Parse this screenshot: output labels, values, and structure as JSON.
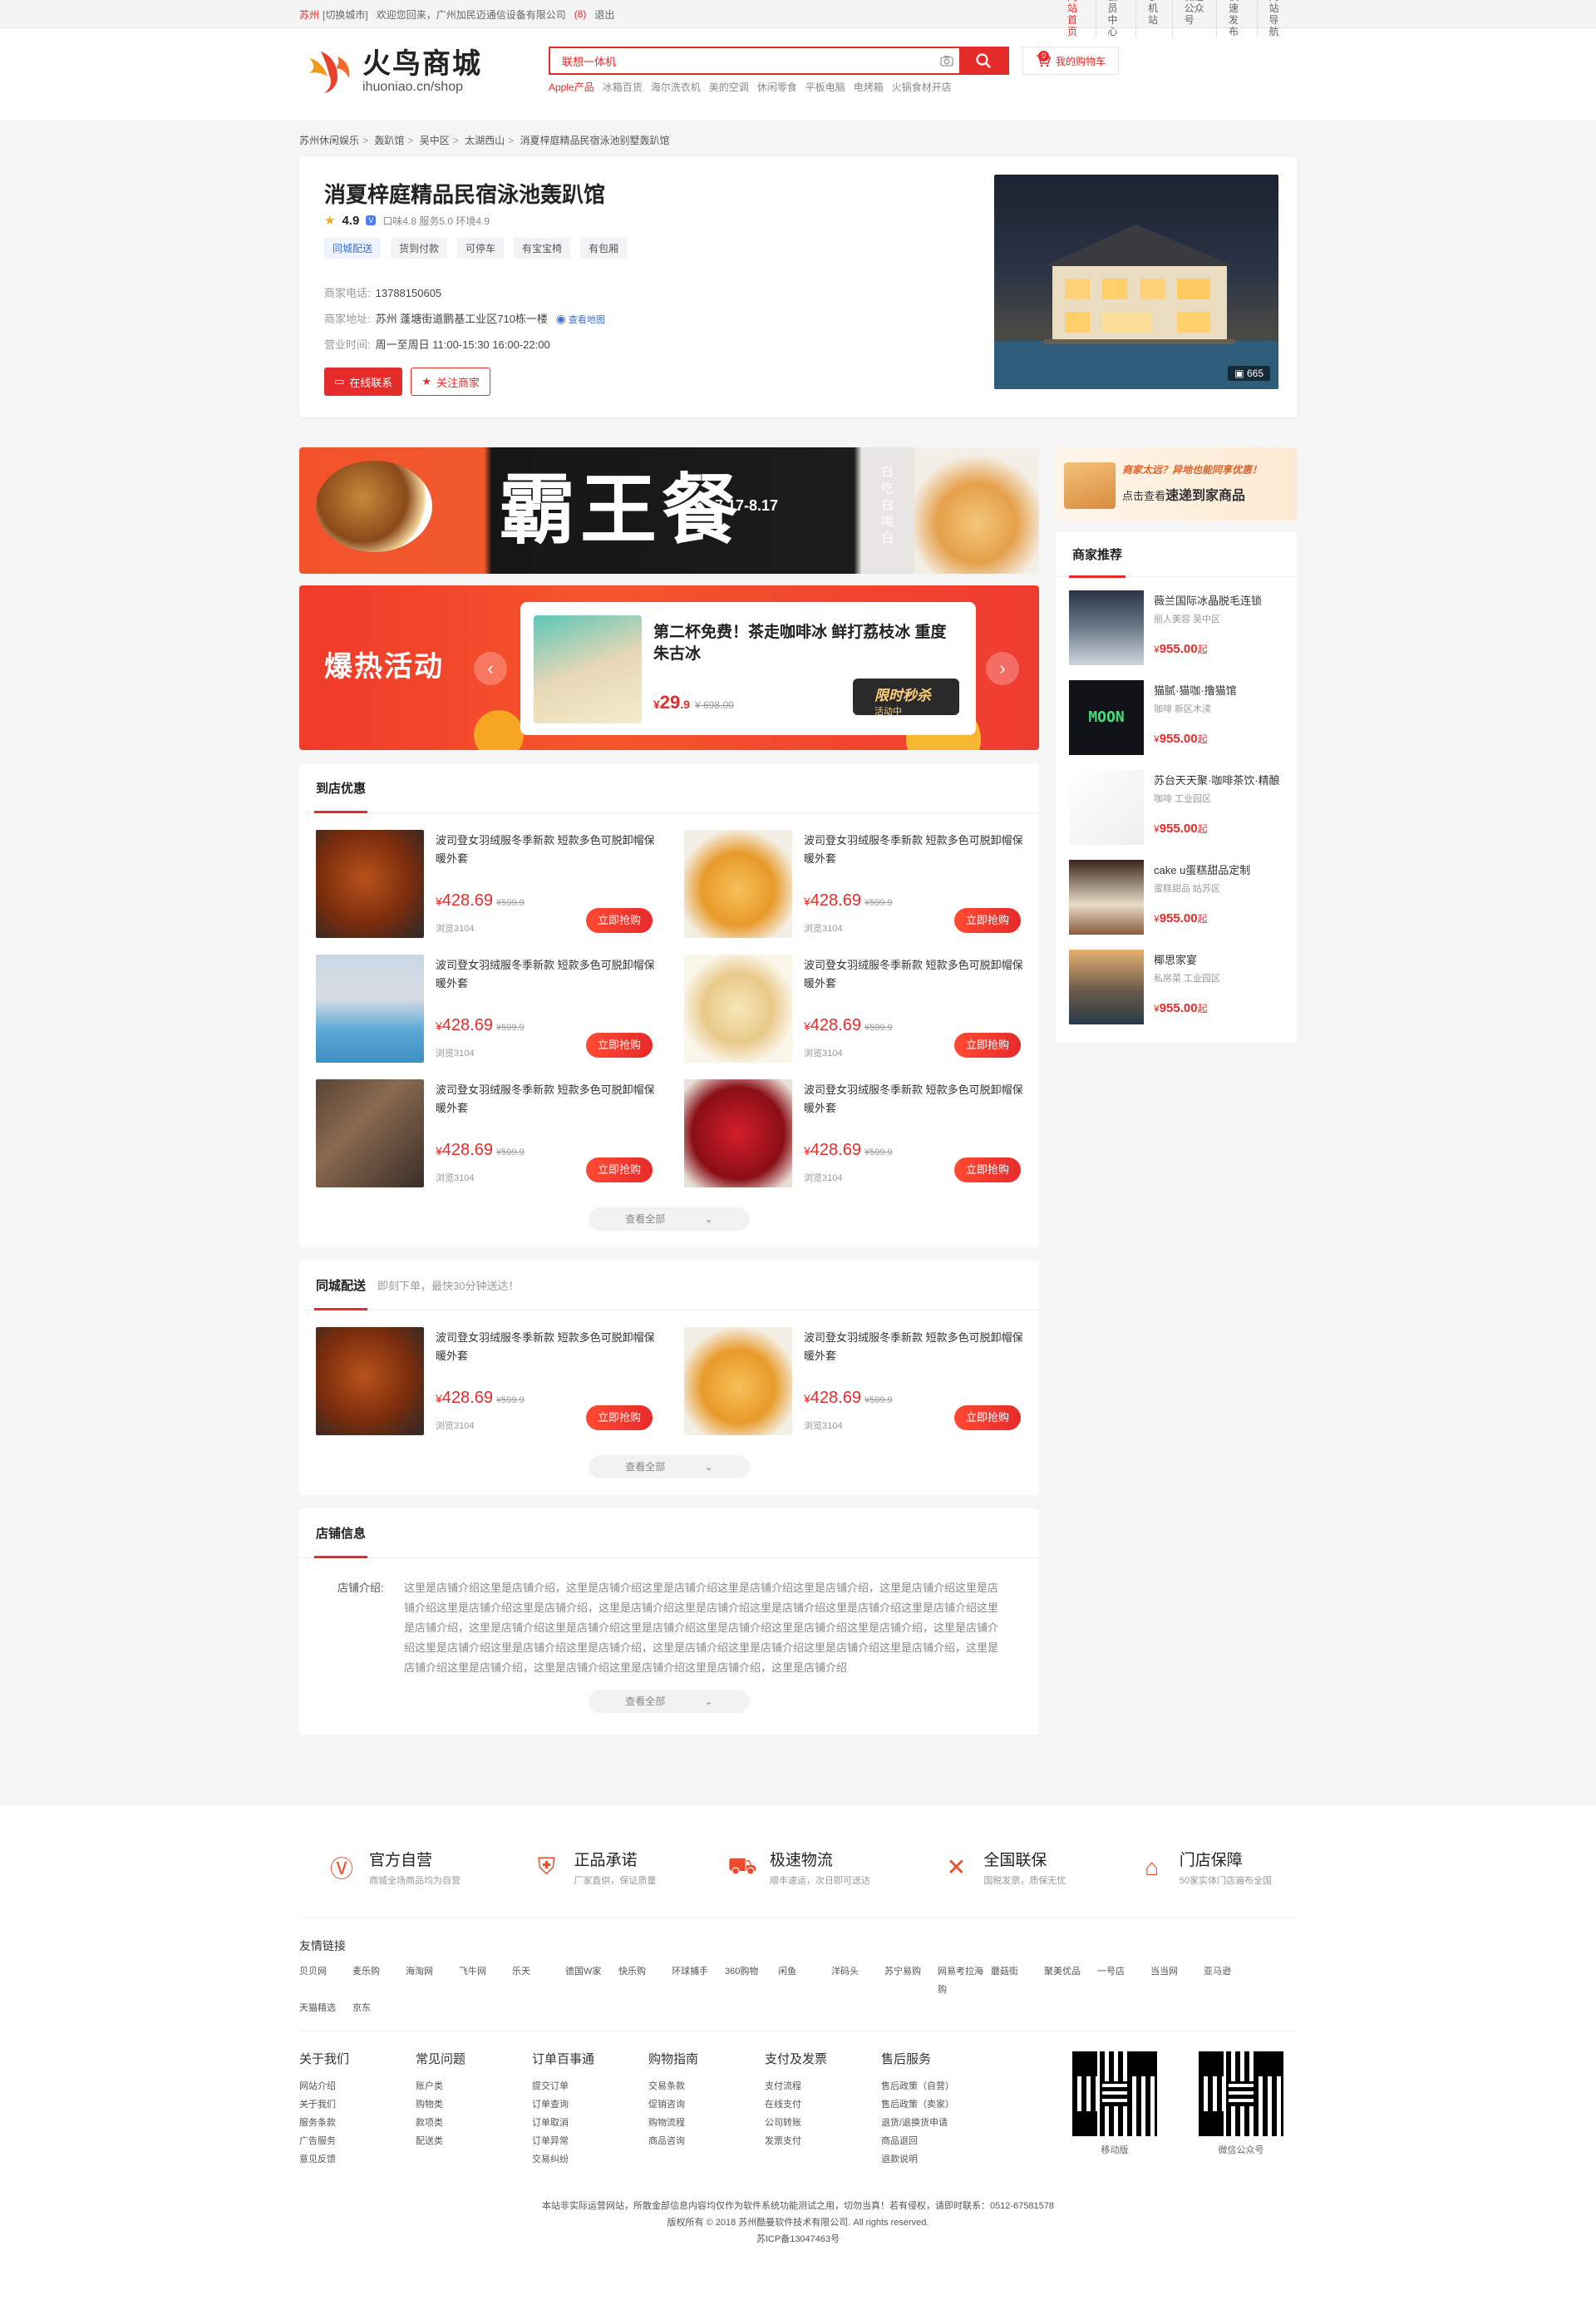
{
  "topbar": {
    "city": "苏州",
    "switch_city": "[切换城市]",
    "welcome": "欢迎您回来，广州加民迈通信设备有限公司",
    "msg_count": "(8)",
    "logout": "退出",
    "links": [
      "网站首页",
      "会员中心",
      "手机站",
      "微信公众号",
      "快速发布",
      "网站导航"
    ]
  },
  "header": {
    "logo_title": "火鸟商城",
    "logo_sub": "ihuoniao.cn/shop",
    "search_value": "联想一体机",
    "hotwords": [
      "Apple产品",
      "冰箱百货",
      "海尔洗衣机",
      "美的空调",
      "休闲零食",
      "平板电脑",
      "电烤箱",
      "火锅食材开店"
    ],
    "cart_label": "我的购物车",
    "cart_count": "0"
  },
  "breadcrumb": [
    "苏州休闲娱乐",
    "轰趴馆",
    "吴中区",
    "太湖西山",
    "消夏梓庭精品民宿泳池别墅轰趴馆"
  ],
  "shop": {
    "name": "消夏梓庭精品民宿泳池轰趴馆",
    "score": "4.9",
    "sub_scores": "口味4.8  服务5.0  环境4.9",
    "tags": [
      "同城配送",
      "货到付款",
      "可停车",
      "有宝宝椅",
      "有包厢"
    ],
    "phone_label": "商家电话:",
    "phone": "13788150605",
    "addr_label": "商家地址:",
    "addr": "苏州  蓬塘街道鹏基工业区710栋一楼",
    "map_link": "查看地图",
    "hours_label": "营业时间:",
    "hours": "周一至周日 11:00-15:30 16:00-22:00",
    "contact_btn": "在线联系",
    "follow_btn": "关注商家",
    "photo_count": "665"
  },
  "banner1": {
    "title": "霸王餐",
    "dates": "7.17-8.17",
    "side_text": "白吃 白喝 白"
  },
  "hot_activity": {
    "title": "爆热活动",
    "deal_title": "第二杯免费！茶走咖啡冰 鲜打荔枝冰 重度朱古冰",
    "price_int": "29",
    "price_dec": ".9",
    "currency": "¥",
    "orig_price": "¥ 698.00",
    "flash_title": "限时秒杀",
    "flash_sub": "活动中",
    "prev": "‹",
    "next": "›"
  },
  "store_deals": {
    "title": "到店优惠",
    "more": "查看全部",
    "items": [
      {
        "name": "波司登女羽绒服冬季新款 短款多色可脱卸帽保暖外套",
        "price": "428.69",
        "orig": "¥599.9",
        "sold": "浏览3104",
        "buy": "立即抢购"
      },
      {
        "name": "波司登女羽绒服冬季新款 短款多色可脱卸帽保暖外套",
        "price": "428.69",
        "orig": "¥599.9",
        "sold": "浏览3104",
        "buy": "立即抢购"
      },
      {
        "name": "波司登女羽绒服冬季新款 短款多色可脱卸帽保暖外套",
        "price": "428.69",
        "orig": "¥599.9",
        "sold": "浏览3104",
        "buy": "立即抢购"
      },
      {
        "name": "波司登女羽绒服冬季新款 短款多色可脱卸帽保暖外套",
        "price": "428.69",
        "orig": "¥599.9",
        "sold": "浏览3104",
        "buy": "立即抢购"
      },
      {
        "name": "波司登女羽绒服冬季新款 短款多色可脱卸帽保暖外套",
        "price": "428.69",
        "orig": "¥599.9",
        "sold": "浏览3104",
        "buy": "立即抢购"
      },
      {
        "name": "波司登女羽绒服冬季新款 短款多色可脱卸帽保暖外套",
        "price": "428.69",
        "orig": "¥599.9",
        "sold": "浏览3104",
        "buy": "立即抢购"
      }
    ]
  },
  "delivery": {
    "title": "同城配送",
    "subtitle": "即刻下单，最快30分钟送达！",
    "more": "查看全部",
    "items": [
      {
        "name": "波司登女羽绒服冬季新款 短款多色可脱卸帽保暖外套",
        "price": "428.69",
        "orig": "¥599.9",
        "sold": "浏览3104",
        "buy": "立即抢购"
      },
      {
        "name": "波司登女羽绒服冬季新款 短款多色可脱卸帽保暖外套",
        "price": "428.69",
        "orig": "¥599.9",
        "sold": "浏览3104",
        "buy": "立即抢购"
      }
    ]
  },
  "store_info": {
    "title": "店铺信息",
    "label": "店铺介绍:",
    "text": "这里是店铺介绍这里是店铺介绍，这里是店铺介绍这里是店铺介绍这里是店铺介绍这里是店铺介绍，这里是店铺介绍这里是店铺介绍这里是店铺介绍这里是店铺介绍，这里是店铺介绍这里是店铺介绍这里是店铺介绍这里是店铺介绍这里是店铺介绍这里是店铺介绍，这里是店铺介绍这里是店铺介绍这里是店铺介绍这里是店铺介绍这里是店铺介绍这里是店铺介绍，这里是店铺介绍这里是店铺介绍这里是店铺介绍这里是店铺介绍，这里是店铺介绍这里是店铺介绍这里是店铺介绍这里是店铺介绍，这里是店铺介绍这里是店铺介绍，这里是店铺介绍这里是店铺介绍这里是店铺介绍，这里是店铺介绍",
    "more": "查看全部"
  },
  "side_promo": {
    "line1": "商家太远？异地也能同享优惠！",
    "line2_pre": "点击查看",
    "line2_bold": "速递到家商品"
  },
  "recommend": {
    "title": "商家推荐",
    "items": [
      {
        "name": "薇兰国际冰晶脱毛连锁",
        "cat": "丽人美容    吴中区",
        "price": "955.00",
        "unit": "起"
      },
      {
        "name": "猫腻·猫咖·撸猫馆",
        "cat": "咖啡    新区木渎",
        "price": "955.00",
        "unit": "起"
      },
      {
        "name": "苏台天天聚·咖啡茶饮·精酿",
        "cat": "咖啡    工业园区",
        "price": "955.00",
        "unit": "起"
      },
      {
        "name": "cake u蛋糕甜品定制",
        "cat": "蛋糕甜品    姑苏区",
        "price": "955.00",
        "unit": "起"
      },
      {
        "name": "椰思家宴",
        "cat": "私房菜    工业园区",
        "price": "955.00",
        "unit": "起"
      }
    ],
    "moon_text": "MOON"
  },
  "footer": {
    "guarantees": [
      {
        "title": "官方自营",
        "sub": "商城全场商品均为自营"
      },
      {
        "title": "正品承诺",
        "sub": "厂家直供，保证质量"
      },
      {
        "title": "极速物流",
        "sub": "顺丰速运，次日即可送达"
      },
      {
        "title": "全国联保",
        "sub": "国税发票，质保无忧"
      },
      {
        "title": "门店保障",
        "sub": "50家实体门店遍布全国"
      }
    ],
    "links_title": "友情链接",
    "links": [
      "贝贝网",
      "麦乐购",
      "海淘网",
      "飞牛网",
      "乐天",
      "德国W家",
      "快乐购",
      "环球捕手",
      "360购物",
      "闲鱼",
      "洋码头",
      "苏宁易购",
      "网易考拉海购",
      "蘑菇街",
      "聚美优品",
      "一号店",
      "当当网",
      "亚马逊",
      "天猫精选",
      "京东"
    ],
    "cols": [
      {
        "title": "关于我们",
        "items": [
          "网站介绍",
          "关于我们",
          "服务条款",
          "广告服务",
          "意见反馈"
        ]
      },
      {
        "title": "常见问题",
        "items": [
          "账户类",
          "购物类",
          "款项类",
          "配送类"
        ]
      },
      {
        "title": "订单百事通",
        "items": [
          "提交订单",
          "订单查询",
          "订单取消",
          "订单异常",
          "交易纠纷"
        ]
      },
      {
        "title": "购物指南",
        "items": [
          "交易条款",
          "促销咨询",
          "购物流程",
          "商品咨询"
        ]
      },
      {
        "title": "支付及发票",
        "items": [
          "支付流程",
          "在线支付",
          "公司转账",
          "发票支付"
        ]
      },
      {
        "title": "售后服务",
        "items": [
          "售后政策（自营）",
          "售后政策（卖家）",
          "退货/退换货申请",
          "商品退回",
          "退款说明"
        ]
      }
    ],
    "qr_mobile": "移动版",
    "qr_wechat": "微信公众号",
    "copy1": "本站非实际运营网站，所散金部信息内容均仅作为软件系统功能测试之用，切勿当真！若有侵权，请即时联系：0512-67581578",
    "copy2": "版权所有 © 2018 苏州酷曼软件技术有限公司. All rights reserved.",
    "copy3": "苏ICP备13047463号"
  },
  "colors": {
    "accent": "#e62b2b",
    "link": "#3e6fd0",
    "orange": "#ef4a2a"
  }
}
